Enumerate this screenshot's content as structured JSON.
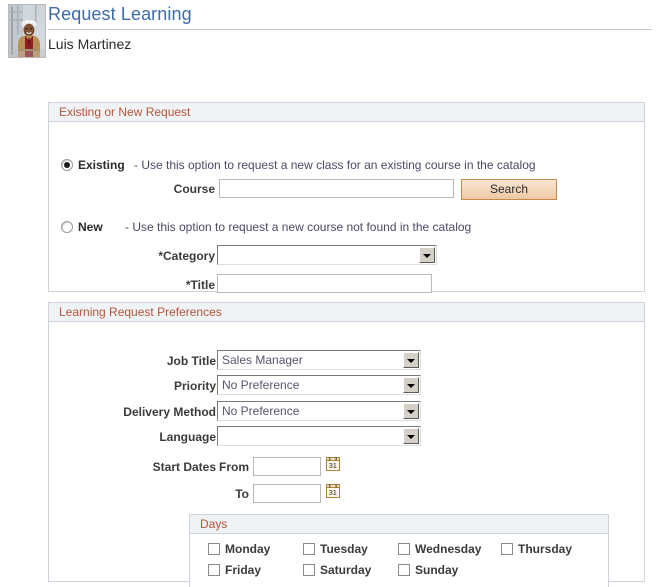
{
  "header": {
    "title": "Request Learning",
    "subtitle": "Luis Martinez",
    "avatar_alt": "employee-photo"
  },
  "panel_existing_new": {
    "legend": "Existing or New Request",
    "existing": {
      "radio_label": "Existing",
      "selected": true,
      "description": "- Use this option to request a new class for an existing course in the catalog",
      "course_label": "Course",
      "course_value": "",
      "search_button": "Search"
    },
    "new": {
      "radio_label": "New",
      "selected": false,
      "description": "- Use this option to request a new course not found in the catalog",
      "category_label": "*Category",
      "category_value": "",
      "title_label": "*Title",
      "title_value": ""
    }
  },
  "panel_preferences": {
    "legend": "Learning Request Preferences",
    "fields": [
      {
        "label": "Job Title",
        "value": "Sales Manager",
        "type": "select"
      },
      {
        "label": "Priority",
        "value": "No Preference",
        "type": "select"
      },
      {
        "label": "Delivery Method",
        "value": "No Preference",
        "type": "select"
      },
      {
        "label": "Language",
        "value": "",
        "type": "select"
      }
    ],
    "start_dates": {
      "group_label": "Start Dates",
      "from_label": "From",
      "from_value": "",
      "to_label": "To",
      "to_value": "",
      "calendar_icon": "calendar-icon"
    },
    "days": {
      "legend": "Days",
      "items": [
        {
          "label": "Monday",
          "checked": false
        },
        {
          "label": "Tuesday",
          "checked": false
        },
        {
          "label": "Wednesday",
          "checked": false
        },
        {
          "label": "Thursday",
          "checked": false
        },
        {
          "label": "Friday",
          "checked": false
        },
        {
          "label": "Saturday",
          "checked": false
        },
        {
          "label": "Sunday",
          "checked": false
        }
      ]
    }
  },
  "colors": {
    "title_blue": "#3f6ca8",
    "legend_rust": "#b5543a",
    "panel_border": "#cdd3db",
    "panel_header_bg": "#f0f3f5",
    "button_border": "#c98b4b",
    "button_bg": "#f4d7bb"
  }
}
